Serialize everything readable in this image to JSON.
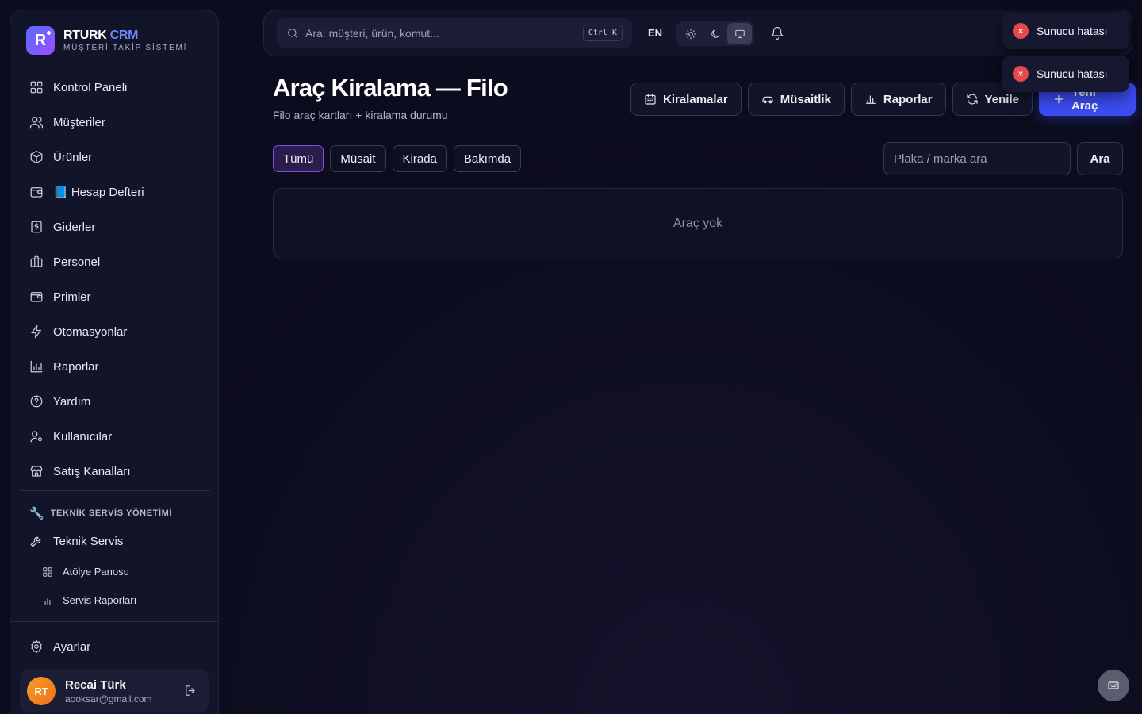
{
  "brand": {
    "logo_letter": "R",
    "name_main": "RTURK",
    "name_accent": "CRM",
    "subtitle": "MÜŞTERİ TAKİP SİSTEMİ"
  },
  "sidebar": {
    "items": [
      {
        "label": "Kontrol Paneli",
        "icon": "grid-icon"
      },
      {
        "label": "Müşteriler",
        "icon": "users-icon"
      },
      {
        "label": "Ürünler",
        "icon": "box-icon"
      },
      {
        "label": "📘 Hesap Defteri",
        "icon": "wallet-icon"
      },
      {
        "label": "Giderler",
        "icon": "receipt-icon"
      },
      {
        "label": "Personel",
        "icon": "briefcase-icon"
      },
      {
        "label": "Primler",
        "icon": "wallet-icon"
      },
      {
        "label": "Otomasyonlar",
        "icon": "bolt-icon"
      },
      {
        "label": "Raporlar",
        "icon": "bar-chart-icon"
      },
      {
        "label": "Yardım",
        "icon": "help-circle-icon"
      },
      {
        "label": "Kullanıcılar",
        "icon": "user-cog-icon"
      },
      {
        "label": "Satış Kanalları",
        "icon": "store-icon"
      }
    ],
    "section_title": "TEKNİK SERVİS YÖNETİMİ",
    "service": {
      "label": "Teknik Servis",
      "icon": "wrench-icon"
    },
    "sub_items": [
      {
        "label": "Atölye Panosu",
        "icon": "grid-icon"
      },
      {
        "label": "Servis Raporları",
        "icon": "bar-chart-icon"
      }
    ],
    "settings": {
      "label": "Ayarlar",
      "icon": "gear-icon"
    }
  },
  "user": {
    "initials": "RT",
    "name": "Recai Türk",
    "email": "aooksar@gmail.com"
  },
  "topbar": {
    "search_placeholder": "Ara: müşteri, ürün, komut...",
    "shortcut": "Ctrl K",
    "language": "EN",
    "theme_active": "system"
  },
  "toasts": [
    {
      "message": "Sunucu hatası"
    },
    {
      "message": "Sunucu hatası"
    }
  ],
  "page": {
    "title": "Araç Kiralama — Filo",
    "subtitle": "Filo araç kartları + kiralama durumu"
  },
  "actions": {
    "rentals": "Kiralamalar",
    "availability": "Müsaitlik",
    "reports": "Raporlar",
    "refresh": "Yenile",
    "new_vehicle": "Yeni Araç"
  },
  "filters": {
    "items": [
      "Tümü",
      "Müsait",
      "Kirada",
      "Bakımda"
    ],
    "active": "Tümü",
    "plate_placeholder": "Plaka / marka ara",
    "search_button": "Ara"
  },
  "empty_state": "Araç yok",
  "colors": {
    "accent": "#3b4cf2",
    "active_chip_border": "#7b4fe0",
    "error": "#e5484d"
  }
}
